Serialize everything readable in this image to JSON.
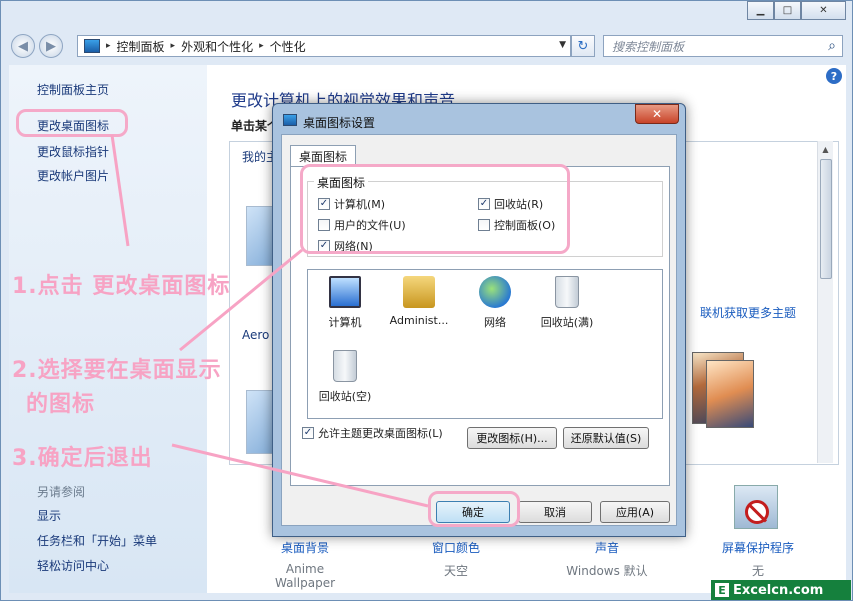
{
  "window": {
    "minimize": "▁",
    "maximize": "□",
    "close": "✕"
  },
  "address": {
    "crumbs": [
      "控制面板",
      "外观和个性化",
      "个性化"
    ],
    "separator": "▸",
    "search_placeholder": "搜索控制面板"
  },
  "left_pane": {
    "home": "控制面板主页",
    "items": [
      "更改桌面图标",
      "更改鼠标指针",
      "更改帐户图片"
    ],
    "see_also": "另请参阅",
    "see_also_items": [
      "显示",
      "任务栏和「开始」菜单",
      "轻松访问中心"
    ]
  },
  "main": {
    "title": "更改计算机上的视觉效果和声音",
    "subtitle": "单击某个",
    "my_themes": "我的主",
    "aero": "Aero 主",
    "online_link": "联机获取更多主题",
    "bottom": [
      {
        "label": "桌面背景",
        "value": "Anime Wallpaper"
      },
      {
        "label": "窗口颜色",
        "value": "天空"
      },
      {
        "label": "声音",
        "value": "Windows 默认"
      },
      {
        "label": "屏幕保护程序",
        "value": "无"
      }
    ]
  },
  "dialog": {
    "title": "桌面图标设置",
    "tab": "桌面图标",
    "group_legend": "桌面图标",
    "checkboxes": [
      {
        "label": "计算机(M)",
        "checked": true
      },
      {
        "label": "回收站(R)",
        "checked": true
      },
      {
        "label": "用户的文件(U)",
        "checked": false
      },
      {
        "label": "控制面板(O)",
        "checked": false
      },
      {
        "label": "网络(N)",
        "checked": true
      }
    ],
    "icons": [
      "计算机",
      "Administ...",
      "网络",
      "回收站(满)",
      "回收站(空)"
    ],
    "change_icon": "更改图标(H)...",
    "restore_default": "还原默认值(S)",
    "allow_themes": "允许主题更改桌面图标(L)",
    "allow_themes_checked": true,
    "ok": "确定",
    "cancel": "取消",
    "apply": "应用(A)",
    "close": "✕"
  },
  "annotations": {
    "step1": "1.点击 更改桌面图标",
    "step2_line1": "2.选择要在桌面显示",
    "step2_line2": "的图标",
    "step3": "3.确定后退出",
    "accent": "#f7a3c4"
  },
  "watermark": {
    "badge": "E",
    "text": "Excelcn.com"
  }
}
